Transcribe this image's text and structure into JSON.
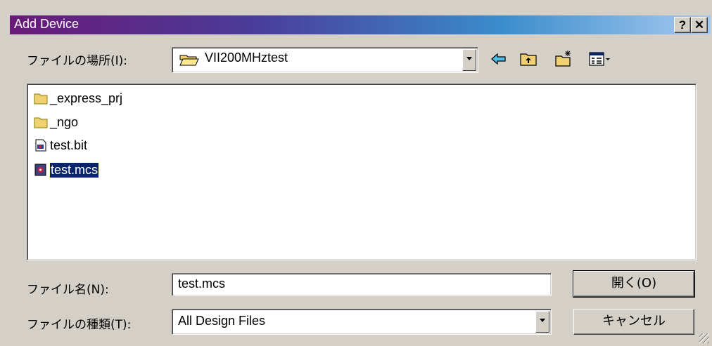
{
  "window": {
    "title": "Add Device"
  },
  "titlebar_buttons": {
    "help": "?",
    "close": "✕"
  },
  "look_in": {
    "label": "ファイルの場所(I):",
    "value": "VII200MHztest"
  },
  "toolbar": {
    "back_icon": "back-arrow-icon",
    "up_icon": "up-folder-icon",
    "newfolder_icon": "new-folder-icon",
    "view_icon": "view-menu-icon"
  },
  "files": [
    {
      "name": "_express_prj",
      "type": "folder"
    },
    {
      "name": "_ngo",
      "type": "folder"
    },
    {
      "name": "test.bit",
      "type": "file"
    },
    {
      "name": "test.mcs",
      "type": "file",
      "selected": true
    }
  ],
  "filename": {
    "label": "ファイル名(N):",
    "value": "test.mcs"
  },
  "filetype": {
    "label": "ファイルの種類(T):",
    "value": "All Design Files"
  },
  "buttons": {
    "open": "開く(O)",
    "cancel": "キャンセル"
  }
}
